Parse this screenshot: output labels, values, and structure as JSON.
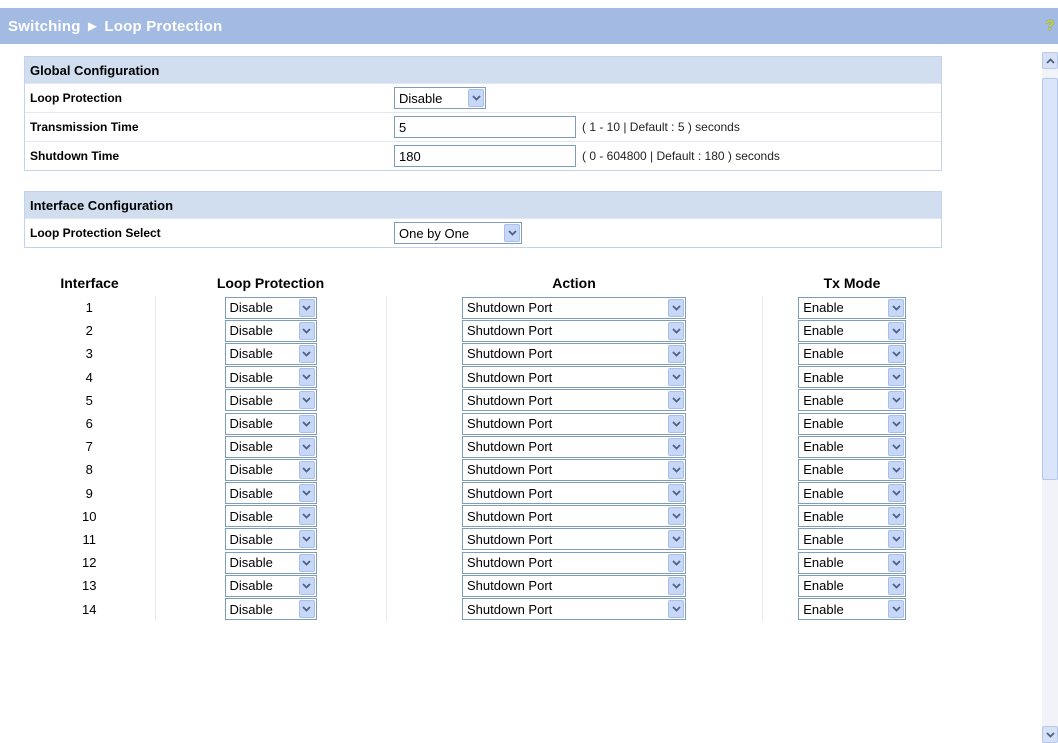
{
  "header": {
    "title": "Switching ► Loop Protection",
    "help_icon": "?"
  },
  "global": {
    "title": "Global Configuration",
    "loop_protection_label": "Loop Protection",
    "loop_protection_value": "Disable",
    "transmission_label": "Transmission Time",
    "transmission_value": "5",
    "transmission_hint": "( 1 - 10 | Default : 5 ) seconds",
    "shutdown_label": "Shutdown Time",
    "shutdown_value": "180",
    "shutdown_hint": "( 0 - 604800 | Default : 180 ) seconds"
  },
  "interface_cfg": {
    "title": "Interface Configuration",
    "select_label": "Loop Protection Select",
    "select_value": "One by One"
  },
  "table": {
    "headers": [
      "Interface",
      "Loop Protection",
      "Action",
      "Tx Mode"
    ],
    "rows": [
      {
        "interface": "1",
        "loop_protection": "Disable",
        "action": "Shutdown Port",
        "tx_mode": "Enable"
      },
      {
        "interface": "2",
        "loop_protection": "Disable",
        "action": "Shutdown Port",
        "tx_mode": "Enable"
      },
      {
        "interface": "3",
        "loop_protection": "Disable",
        "action": "Shutdown Port",
        "tx_mode": "Enable"
      },
      {
        "interface": "4",
        "loop_protection": "Disable",
        "action": "Shutdown Port",
        "tx_mode": "Enable"
      },
      {
        "interface": "5",
        "loop_protection": "Disable",
        "action": "Shutdown Port",
        "tx_mode": "Enable"
      },
      {
        "interface": "6",
        "loop_protection": "Disable",
        "action": "Shutdown Port",
        "tx_mode": "Enable"
      },
      {
        "interface": "7",
        "loop_protection": "Disable",
        "action": "Shutdown Port",
        "tx_mode": "Enable"
      },
      {
        "interface": "8",
        "loop_protection": "Disable",
        "action": "Shutdown Port",
        "tx_mode": "Enable"
      },
      {
        "interface": "9",
        "loop_protection": "Disable",
        "action": "Shutdown Port",
        "tx_mode": "Enable"
      },
      {
        "interface": "10",
        "loop_protection": "Disable",
        "action": "Shutdown Port",
        "tx_mode": "Enable"
      },
      {
        "interface": "11",
        "loop_protection": "Disable",
        "action": "Shutdown Port",
        "tx_mode": "Enable"
      },
      {
        "interface": "12",
        "loop_protection": "Disable",
        "action": "Shutdown Port",
        "tx_mode": "Enable"
      },
      {
        "interface": "13",
        "loop_protection": "Disable",
        "action": "Shutdown Port",
        "tx_mode": "Enable"
      },
      {
        "interface": "14",
        "loop_protection": "Disable",
        "action": "Shutdown Port",
        "tx_mode": "Enable"
      }
    ]
  },
  "colors": {
    "header_bg": "#a3bbe3",
    "panel_head_bg": "#d1def0",
    "dropdown_arrow_bg": "#c7d7f7",
    "dropdown_arrow_fg": "#4d6185"
  },
  "icons": {
    "help": "help-question-icon",
    "dropdown": "chevron-down-icon",
    "scroll_up": "chevron-up-icon",
    "scroll_down": "chevron-down-icon"
  }
}
